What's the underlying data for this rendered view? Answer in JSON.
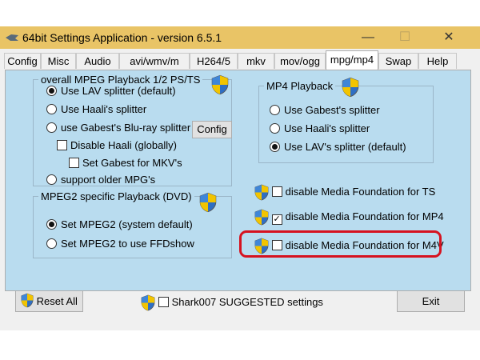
{
  "window": {
    "title": "64bit Settings Application - version 6.5.1",
    "minimize": "—",
    "maximize": "☐",
    "close": "✕"
  },
  "tabs": [
    "Config",
    "Misc",
    "Audio",
    "avi/wmv/m",
    "H264/5",
    "mkv",
    "mov/ogg",
    "mpg/mp4",
    "Swap",
    "Help"
  ],
  "active_tab": "mpg/mp4",
  "mpeg_group": {
    "legend": "overall MPEG Playback 1/2 PS/TS",
    "lav": "Use LAV splitter (default)",
    "haali": "Use Haali's splitter",
    "gabest_bluray": "use Gabest's Blu-ray splitter",
    "config_button": "Config",
    "disable_haali": "Disable Haali (globally)",
    "set_gabest_mkv": "Set Gabest for MKV's",
    "older_mpg": "support older MPG's"
  },
  "mpeg2_group": {
    "legend": "MPEG2 specific Playback (DVD)",
    "set_mpeg2": "Set MPEG2 (system default)",
    "set_ffdshow": "Set MPEG2 to use FFDshow"
  },
  "mp4_group": {
    "legend": "MP4 Playback",
    "gabest": "Use Gabest's splitter",
    "haali": "Use Haali's splitter",
    "lav": "Use LAV's splitter (default)"
  },
  "media_foundation": {
    "ts": "disable Media Foundation for TS",
    "mp4": "disable Media Foundation for MP4",
    "m4v": "disable Media Foundation for M4V",
    "check_mark": "✓"
  },
  "footer": {
    "reset_all": "Reset All",
    "suggested": "Shark007 SUGGESTED settings",
    "exit": "Exit"
  },
  "colors": {
    "titlebar": "#e9c466",
    "panel": "#b9dcef",
    "highlight": "#d6121f"
  }
}
